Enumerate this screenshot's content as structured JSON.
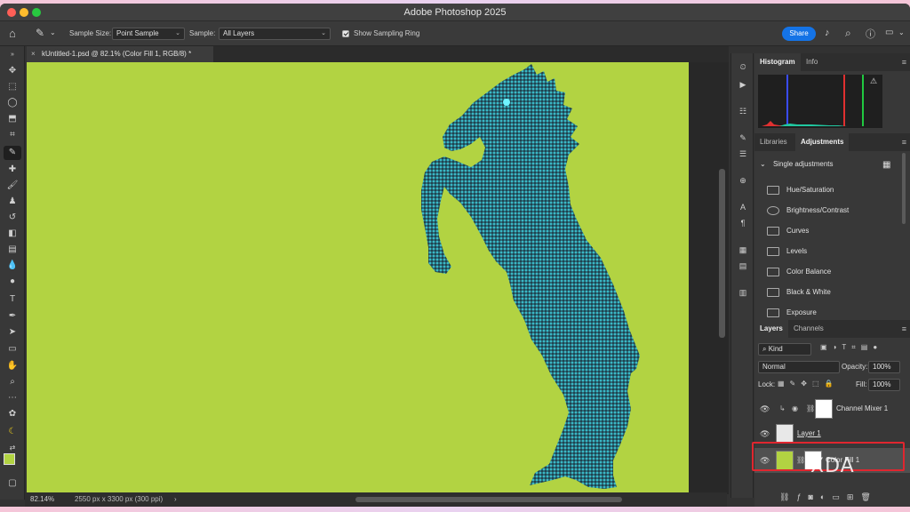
{
  "app": {
    "title": "Adobe Photoshop 2025"
  },
  "options_bar": {
    "sample_size_label": "Sample Size:",
    "sample_size_value": "Point Sample",
    "sample_label": "Sample:",
    "sample_value": "All Layers",
    "show_sampling_ring_label": "Show Sampling Ring",
    "share_label": "Share"
  },
  "document": {
    "tab_title": "kUntitled-1.psd @ 82.1% (Color Fill 1, RGB/8) *",
    "zoom": "82.14%",
    "dimensions": "2550 px x 3300 px (300 ppi)",
    "fill_color": "#b2d342"
  },
  "panels": {
    "histogram_tab": "Histogram",
    "info_tab": "Info",
    "libraries_tab": "Libraries",
    "adjustments_tab": "Adjustments",
    "single_adjustments": "Single adjustments",
    "adjustments": [
      "Hue/Saturation",
      "Brightness/Contrast",
      "Curves",
      "Levels",
      "Color Balance",
      "Black & White",
      "Exposure"
    ],
    "layers_tab": "Layers",
    "channels_tab": "Channels",
    "kind": "Kind",
    "blend_mode": "Normal",
    "opacity_label": "Opacity:",
    "opacity_value": "100%",
    "lock_label": "Lock:",
    "fill_label": "Fill:",
    "fill_value": "100%",
    "layers": [
      {
        "name": "Channel Mixer 1"
      },
      {
        "name": "Layer 1"
      },
      {
        "name": "Color Fill 1"
      }
    ]
  },
  "watermark": "XDA"
}
